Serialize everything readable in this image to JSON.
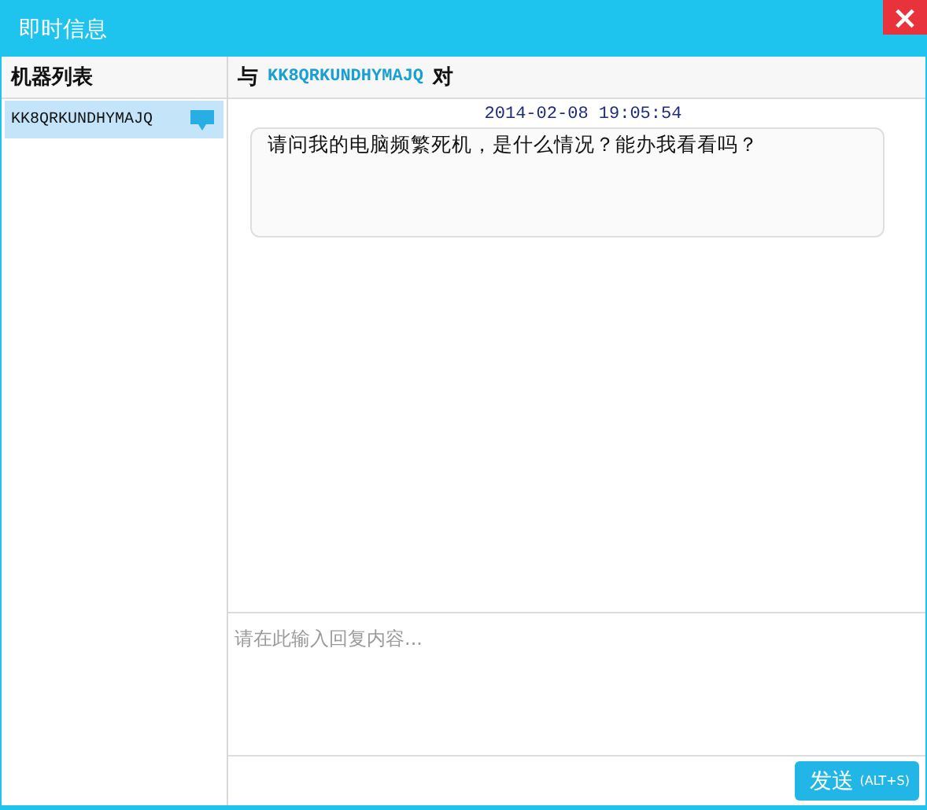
{
  "window": {
    "title": "即时信息",
    "close_label": "×"
  },
  "sidebar": {
    "title": "机器列表",
    "items": [
      {
        "name": "KK8QRKUNDHYMAJQ",
        "selected": true,
        "has_message": true
      }
    ]
  },
  "chat": {
    "header": {
      "prefix": "与",
      "peer": "KK8QRKUNDHYMAJQ",
      "suffix": "对"
    },
    "messages": [
      {
        "time": "2014-02-08 19:05:54",
        "text": "请问我的电脑频繁死机，是什么情况？能办我看看吗？"
      }
    ],
    "input": {
      "placeholder": "请在此输入回复内容..."
    },
    "send_button": {
      "label": "发送",
      "shortcut": "(ALT+S)"
    }
  }
}
